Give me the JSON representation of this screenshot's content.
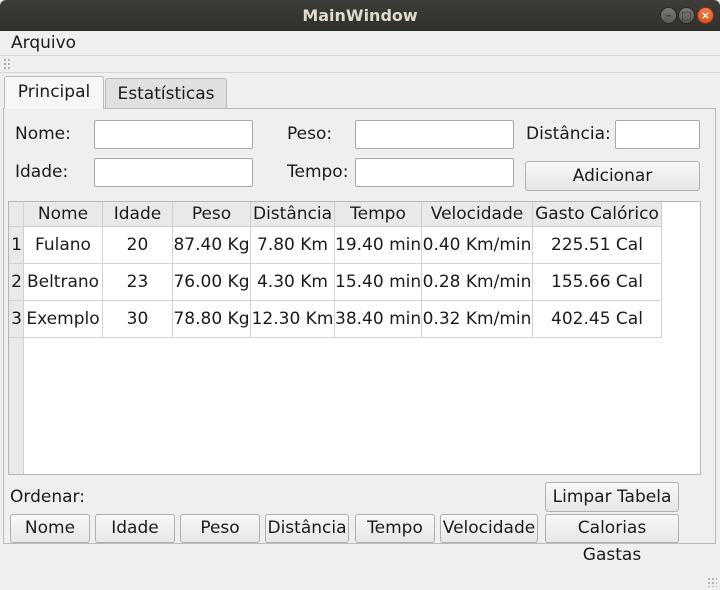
{
  "window": {
    "title": "MainWindow"
  },
  "menu": {
    "file": "Arquivo"
  },
  "tabs": [
    {
      "label": "Principal",
      "active": true
    },
    {
      "label": "Estatísticas",
      "active": false
    }
  ],
  "form": {
    "nome_label": "Nome:",
    "idade_label": "Idade:",
    "peso_label": "Peso:",
    "tempo_label": "Tempo:",
    "distancia_label": "Distância:",
    "nome_value": "",
    "idade_value": "",
    "peso_value": "",
    "tempo_value": "",
    "distancia_value": "",
    "add_button": "Adicionar"
  },
  "table": {
    "headers": [
      "Nome",
      "Idade",
      "Peso",
      "Distância",
      "Tempo",
      "Velocidade",
      "Gasto Calórico"
    ],
    "row_numbers": [
      "1",
      "2",
      "3"
    ],
    "rows": [
      [
        "Fulano",
        "20",
        "87.40 Kg",
        "7.80 Km",
        "19.40 min",
        "0.40 Km/min",
        "225.51 Cal"
      ],
      [
        "Beltrano",
        "23",
        "76.00 Kg",
        "4.30 Km",
        "15.40 min",
        "0.28 Km/min",
        "155.66 Cal"
      ],
      [
        "Exemplo",
        "30",
        "78.80 Kg",
        "12.30 Km",
        "38.40 min",
        "0.32 Km/min",
        "402.45 Cal"
      ]
    ]
  },
  "sort": {
    "label": "Ordenar:",
    "buttons": [
      "Nome",
      "Idade",
      "Peso",
      "Distância",
      "Tempo",
      "Velocidade",
      "Calorias Gastas"
    ]
  },
  "clear_button": "Limpar Tabela"
}
